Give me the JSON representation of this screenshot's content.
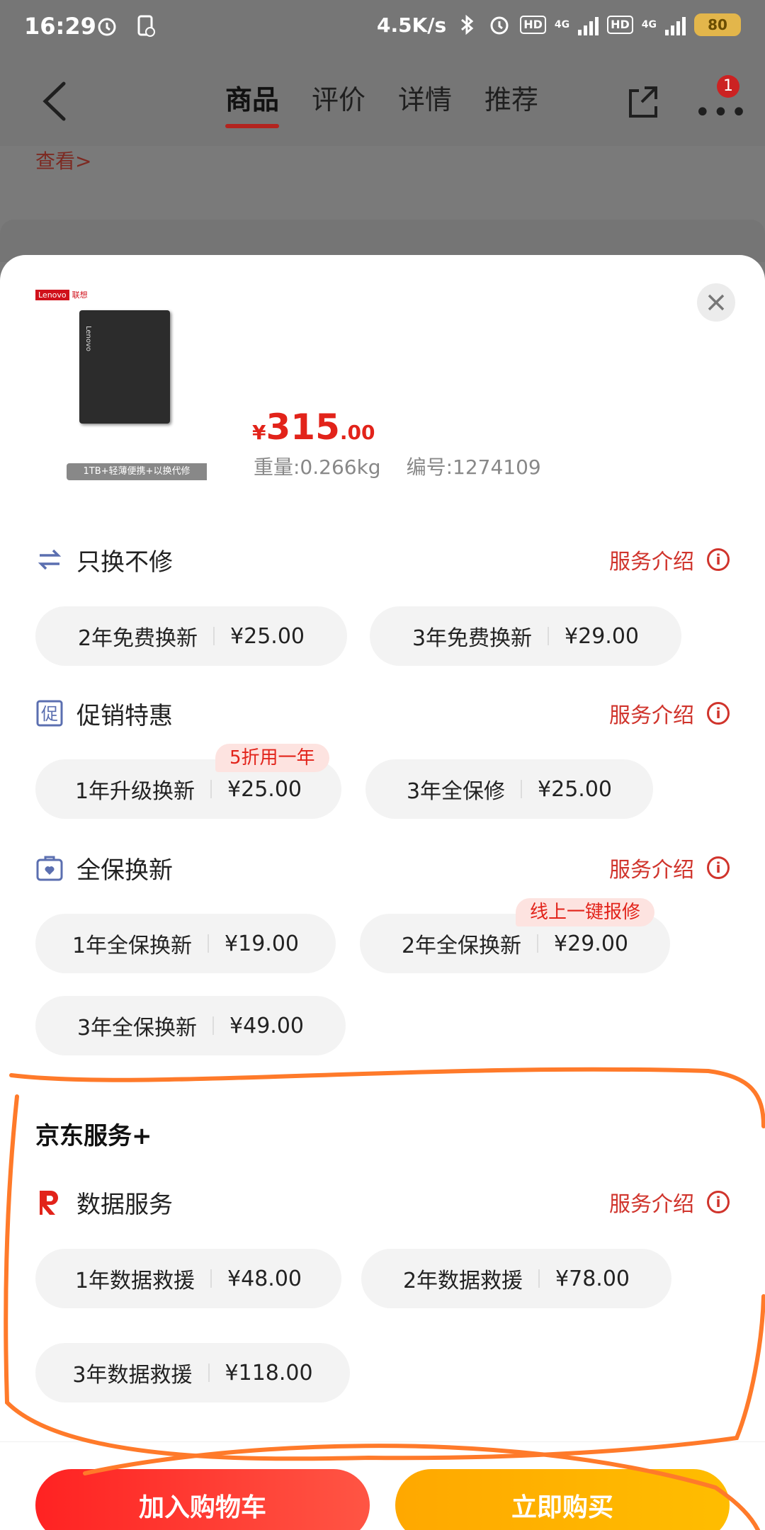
{
  "status": {
    "time": "16:29",
    "net_speed": "4.5K/s",
    "hd1": "HD",
    "hd2": "HD",
    "net1": "4G",
    "net2": "4G",
    "battery": "80"
  },
  "nav": {
    "tabs": [
      "商品",
      "评价",
      "详情",
      "推荐"
    ],
    "active_tab": 0,
    "badge": "1"
  },
  "product": {
    "brand_en": "Lenovo",
    "brand_cn": "联想",
    "thumb_caption": "1TB+轻薄便携+以换代修",
    "price_currency": "¥",
    "price_int": "315",
    "price_dec": ".00",
    "weight": "重量:0.266kg",
    "sku": "编号:1274109"
  },
  "intro_label": "服务介绍",
  "sections": [
    {
      "title": "只换不修",
      "icon": "swap-icon",
      "options": [
        {
          "name": "2年免费换新",
          "price": "¥25.00"
        },
        {
          "name": "3年免费换新",
          "price": "¥29.00"
        }
      ]
    },
    {
      "title": "促销特惠",
      "icon": "promo-icon",
      "options": [
        {
          "name": "1年升级换新",
          "price": "¥25.00",
          "tag": "5折用一年"
        },
        {
          "name": "3年全保修",
          "price": "¥25.00"
        }
      ]
    },
    {
      "title": "全保换新",
      "icon": "protect-icon",
      "options": [
        {
          "name": "1年全保换新",
          "price": "¥19.00"
        },
        {
          "name": "2年全保换新",
          "price": "¥29.00",
          "tag": "线上一键报修"
        },
        {
          "name": "3年全保换新",
          "price": "¥49.00"
        }
      ]
    }
  ],
  "jd_service": {
    "title": "京东服务+",
    "section": {
      "title": "数据服务",
      "icon": "data-service-icon",
      "options": [
        {
          "name": "1年数据救援",
          "price": "¥48.00"
        },
        {
          "name": "2年数据救援",
          "price": "¥78.00"
        },
        {
          "name": "3年数据救援",
          "price": "¥118.00"
        }
      ]
    }
  },
  "buttons": {
    "add_cart": "加入购物车",
    "buy_now": "立即购买"
  },
  "colors": {
    "accent": "#e2231a",
    "buy": "#ffb000",
    "annotation": "#ff7a2a"
  }
}
